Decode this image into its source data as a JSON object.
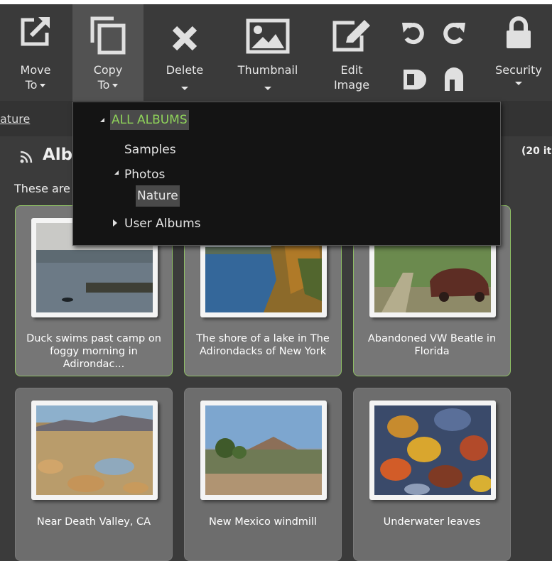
{
  "toolbar": {
    "move": {
      "label1": "Move",
      "label2": "To",
      "icon": "move-to-icon"
    },
    "copy": {
      "label1": "Copy",
      "label2": "To",
      "icon": "copy-to-icon"
    },
    "delete": {
      "label": "Delete",
      "icon": "delete-icon"
    },
    "thumbnail": {
      "label": "Thumbnail",
      "icon": "thumbnail-icon"
    },
    "edit": {
      "label1": "Edit",
      "label2": "Image",
      "icon": "edit-image-icon"
    },
    "rotate_icons": [
      "rotate-left-icon",
      "rotate-right-icon",
      "flip-horizontal-icon",
      "flip-vertical-icon"
    ],
    "security": {
      "label": "Security",
      "icon": "lock-icon"
    }
  },
  "breadcrumb": {
    "current": "ature"
  },
  "album": {
    "title": "Alb",
    "count": "(20 it",
    "description": "These are"
  },
  "dropdown": {
    "items": [
      {
        "label": "ALL ALBUMS",
        "expanded": true,
        "selected": true
      },
      {
        "label": "Samples"
      },
      {
        "label": "Photos",
        "expanded": true
      },
      {
        "label": "Nature",
        "highlighted": true
      },
      {
        "label": "User Albums",
        "expanded": false
      }
    ]
  },
  "cards": [
    {
      "caption": "Duck swims past camp on foggy morning in Adirondac...",
      "selected": true
    },
    {
      "caption": "The shore of a lake in The Adirondacks of New York",
      "selected": true
    },
    {
      "caption": "Abandoned VW Beatle in Florida",
      "selected": true
    },
    {
      "caption": "Near Death Valley, CA",
      "selected": false
    },
    {
      "caption": "New Mexico windmill",
      "selected": false
    },
    {
      "caption": "Underwater leaves",
      "selected": false
    }
  ],
  "colors": {
    "accent_green": "#8fd35a",
    "selected_border": "#8fbf66",
    "toolbar_bg": "#3a3a3a",
    "dropdown_bg": "#141414"
  }
}
